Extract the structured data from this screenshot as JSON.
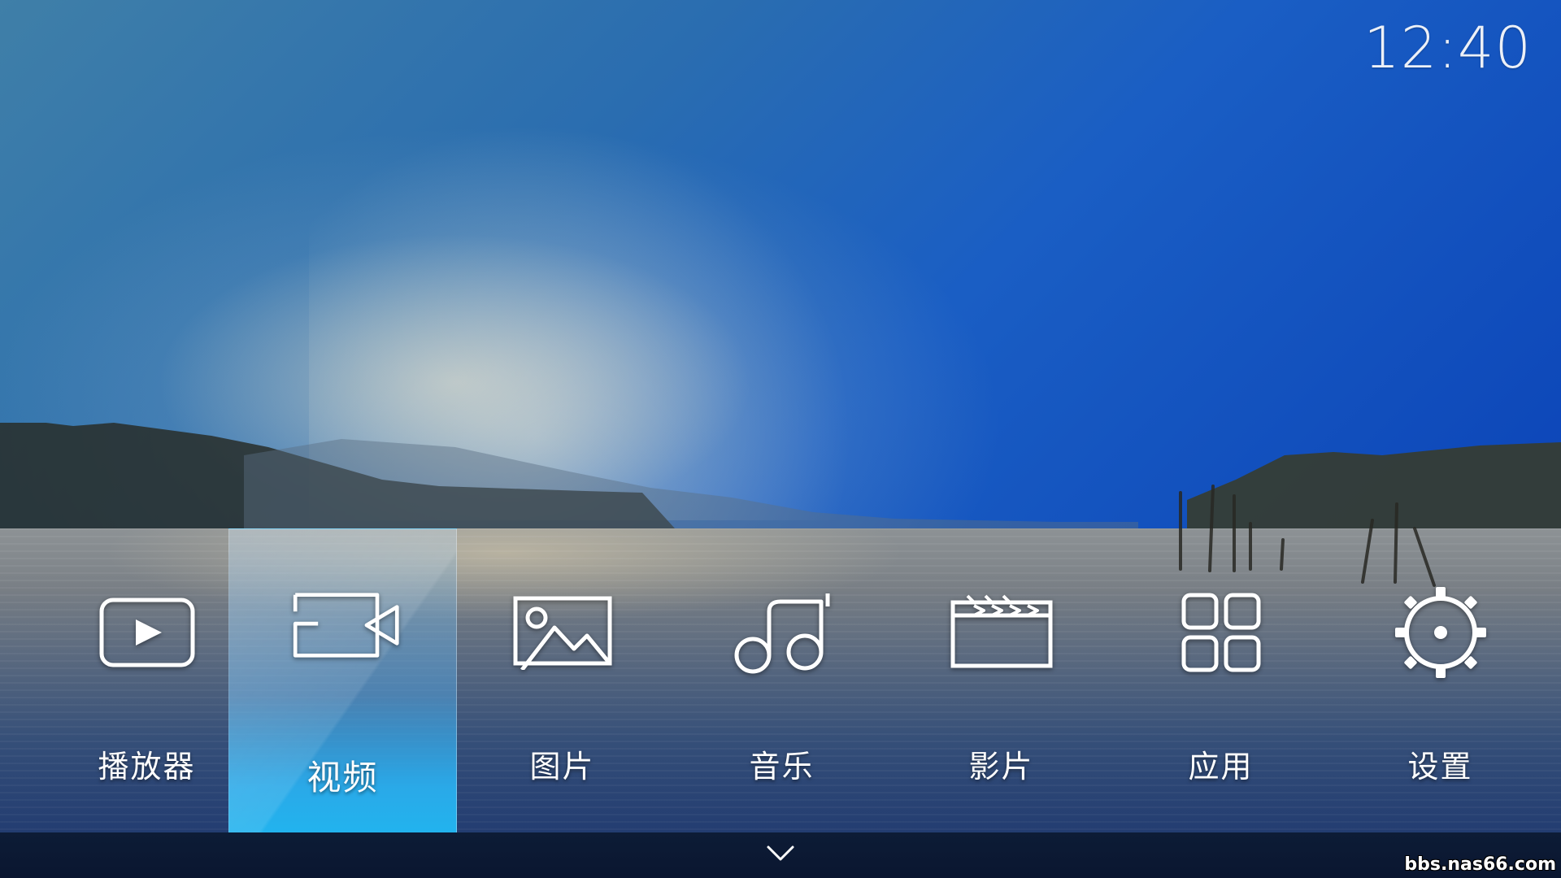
{
  "clock": {
    "time": "12:40"
  },
  "menu": {
    "selected_index": 1,
    "items": [
      {
        "label": "播放器",
        "icon": "play-icon"
      },
      {
        "label": "视频",
        "icon": "video-camera-icon"
      },
      {
        "label": "图片",
        "icon": "picture-icon"
      },
      {
        "label": "音乐",
        "icon": "music-note-icon"
      },
      {
        "label": "影片",
        "icon": "clapperboard-icon"
      },
      {
        "label": "应用",
        "icon": "apps-grid-icon"
      },
      {
        "label": "设置",
        "icon": "gear-icon"
      }
    ]
  },
  "bottom_bar": {
    "expand_icon": "chevron-down-icon",
    "watermark": "bbs.nas66.com"
  },
  "colors": {
    "selected_highlight": "#22b3ee",
    "bottom_bar": "#0d1c36",
    "text": "#ffffff"
  }
}
